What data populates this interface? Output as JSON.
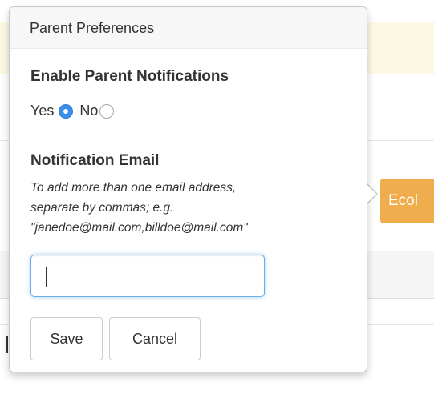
{
  "popover": {
    "title": "Parent Preferences",
    "notifications": {
      "heading": "Enable Parent Notifications",
      "options": [
        {
          "label": "Yes",
          "selected": true
        },
        {
          "label": "No",
          "selected": false
        }
      ]
    },
    "email": {
      "heading": "Notification Email",
      "help_line1": "To add more than one email address,",
      "help_line2": "separate by commas; e.g.",
      "help_line3": "\"janedoe@mail.com,billdoe@mail.com\"",
      "value": "",
      "placeholder": ""
    },
    "buttons": {
      "save": "Save",
      "cancel": "Cancel"
    }
  },
  "background": {
    "button_label": "Ecol"
  },
  "colors": {
    "radio_checked": "#3d8ee8",
    "background_button": "#f0ad4e",
    "alert_background": "#fcf8e3",
    "input_focus_border": "#66afe9"
  }
}
